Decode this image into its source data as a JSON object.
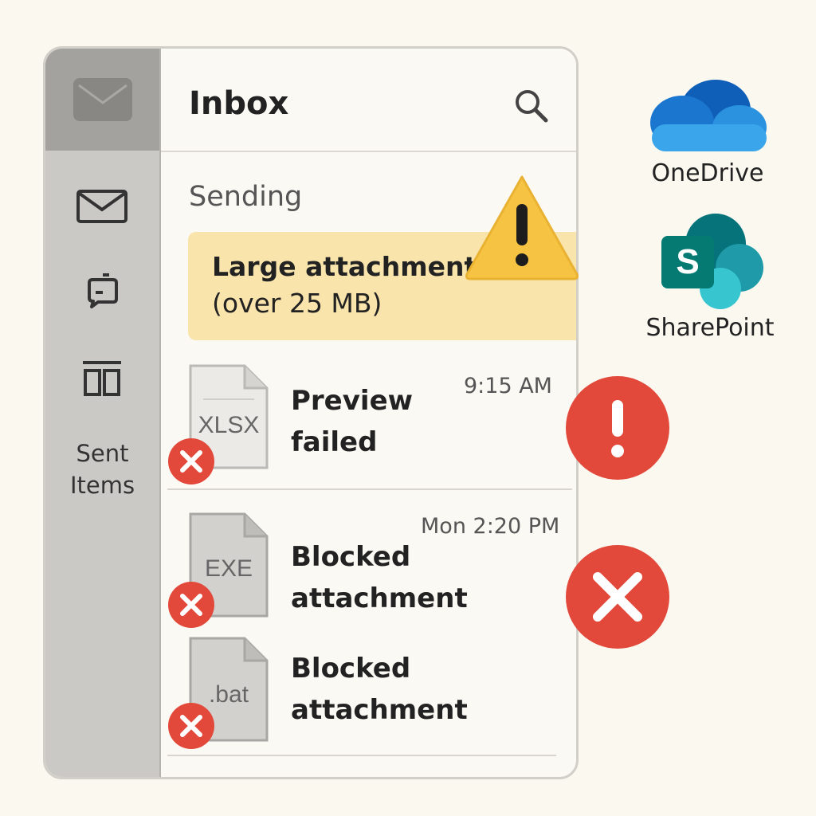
{
  "window": {
    "title": "Inbox",
    "section_label": "Sending"
  },
  "sidebar": {
    "sent_label_line1": "Sent",
    "sent_label_line2": "Items",
    "icons": [
      "mail-icon",
      "chat-icon",
      "archive-icon"
    ]
  },
  "banner": {
    "line1": "Large attachment",
    "line2": "(over 25 MB)",
    "icon": "warning-icon"
  },
  "messages": [
    {
      "file_ext": "XLSX",
      "title_line1": "Preview",
      "title_line2": "failed",
      "time": "9:15 AM",
      "status_icon": "error-exclamation-icon"
    },
    {
      "file_ext": "EXE",
      "title_line1": "Blocked",
      "title_line2": "attachment",
      "time": "Mon 2:20 PM",
      "status_icon": "blocked-x-icon"
    },
    {
      "file_ext": ".bat",
      "title_line1": "Blocked",
      "title_line2": "attachment",
      "time": "",
      "status_icon": "remove-x-icon"
    }
  ],
  "services": [
    {
      "name": "OneDrive",
      "icon": "onedrive-icon"
    },
    {
      "name": "SharePoint",
      "icon": "sharepoint-icon",
      "letter": "S"
    }
  ],
  "colors": {
    "warning": "#f6c343",
    "error": "#e2493b",
    "banner": "#f9e4ac",
    "sidebar": "#cac9c6"
  }
}
